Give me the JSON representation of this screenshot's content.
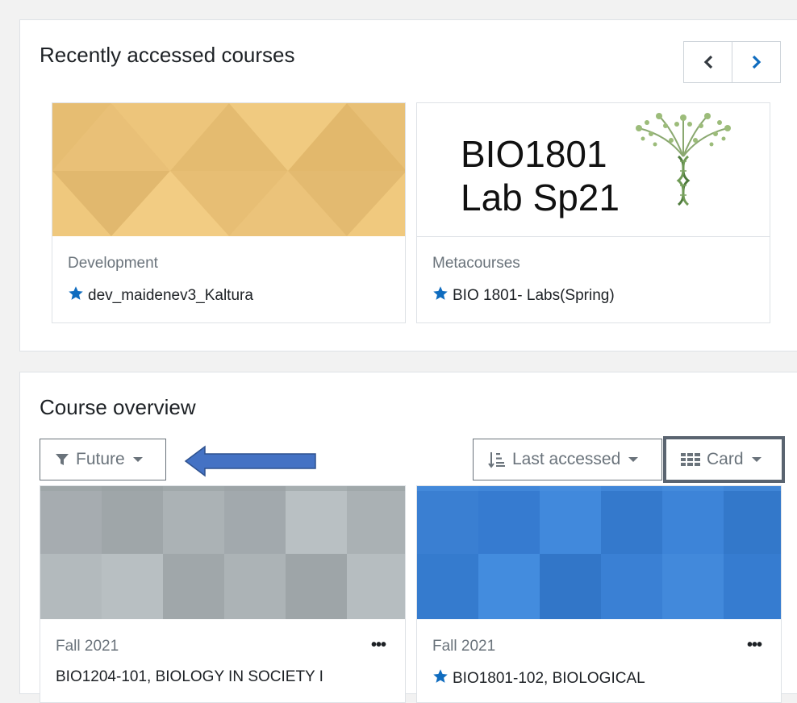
{
  "recent": {
    "title": "Recently accessed courses",
    "courses": [
      {
        "category": "Development",
        "name": "dev_maidenev3_Kaltura"
      },
      {
        "category": "Metacourses",
        "name": "BIO 1801- Labs(Spring)",
        "image_text_line1": "BIO1801",
        "image_text_line2": "Lab Sp21"
      }
    ]
  },
  "overview": {
    "title": "Course overview",
    "filter_label": "Future",
    "sort_label": "Last accessed",
    "view_label": "Card",
    "courses": [
      {
        "term": "Fall 2021",
        "name": "BIO1204-101, BIOLOGY IN SOCIETY I"
      },
      {
        "term": "Fall 2021",
        "name": "BIO1801-102, BIOLOGICAL"
      }
    ],
    "more_glyph": "•••"
  },
  "colors": {
    "accent_blue": "#0f6cbf",
    "arrow_blue": "#4472c4",
    "gold": "#f0c87a",
    "gray_tile": "#a8b0b4",
    "blue_tile": "#3a82d6"
  },
  "icons": [
    "chevron-left-icon",
    "chevron-right-icon",
    "star-icon",
    "filter-icon",
    "sort-icon",
    "grid-icon",
    "ellipsis-icon",
    "arrow-left-icon",
    "dna-tree-icon"
  ]
}
